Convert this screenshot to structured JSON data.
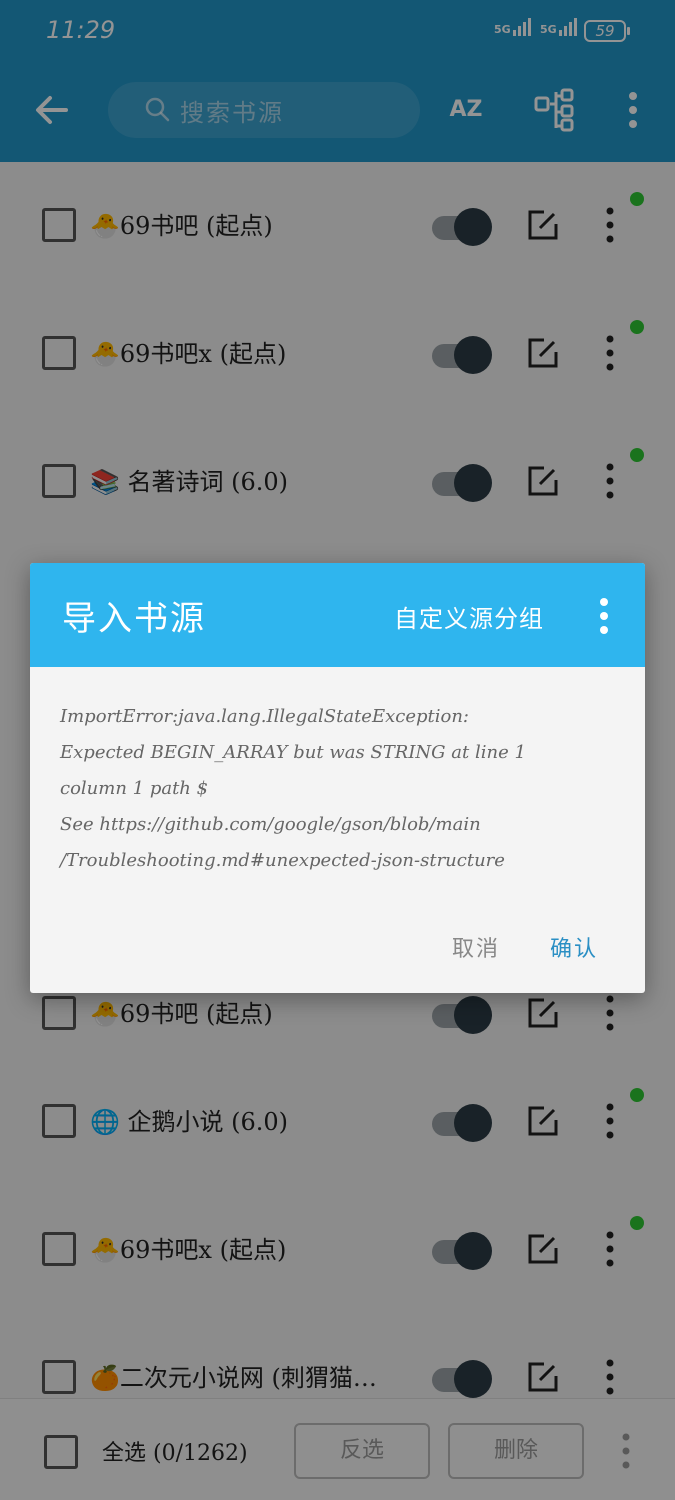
{
  "status_bar": {
    "time": "11:29",
    "signal_1": "5G",
    "signal_2": "5G",
    "battery": "59"
  },
  "toolbar": {
    "search_placeholder": "搜索书源",
    "sort_icon_text": "AZ",
    "icons": [
      "back-arrow-icon",
      "search-icon",
      "sort-az-icon",
      "group-icon",
      "more-vertical-icon"
    ]
  },
  "sources": [
    {
      "name": "🐣69书吧 (起点)",
      "enabled": true,
      "status_dot": true
    },
    {
      "name": "🐣69书吧x (起点)",
      "enabled": true,
      "status_dot": true
    },
    {
      "name": "📚 名著诗词 (6.0)",
      "enabled": true,
      "status_dot": true
    },
    {
      "name": "",
      "enabled": true,
      "status_dot": false
    },
    {
      "name": "",
      "enabled": true,
      "status_dot": false
    },
    {
      "name": "🐣69书吧 (起点)",
      "enabled": true,
      "status_dot": false
    },
    {
      "name": "🌐 企鹅小说 (6.0)",
      "enabled": true,
      "status_dot": true
    },
    {
      "name": "🐣69书吧x (起点)",
      "enabled": true,
      "status_dot": true
    },
    {
      "name": "🍊二次元小说网 (刺猬猫…",
      "enabled": true,
      "status_dot": false
    }
  ],
  "bottom_bar": {
    "select_all": "全选 (0/1262)",
    "invert_label": "反选",
    "delete_label": "删除"
  },
  "dialog": {
    "title": "导入书源",
    "custom_group": "自定义源分组",
    "message_lines": [
      "ImportError:java.lang.IllegalStateException:",
      "Expected BEGIN_ARRAY but was STRING at line 1",
      "column 1 path $",
      "See https://github.com/google/gson/blob/main",
      "/Troubleshooting.md#unexpected-json-structure"
    ],
    "cancel_label": "取消",
    "confirm_label": "确认"
  },
  "colors": {
    "toolbar": "#2196c9",
    "dialog_header": "#2fb5ee",
    "status_dot": "#2ec632",
    "confirm_text": "#2a8fc4"
  }
}
